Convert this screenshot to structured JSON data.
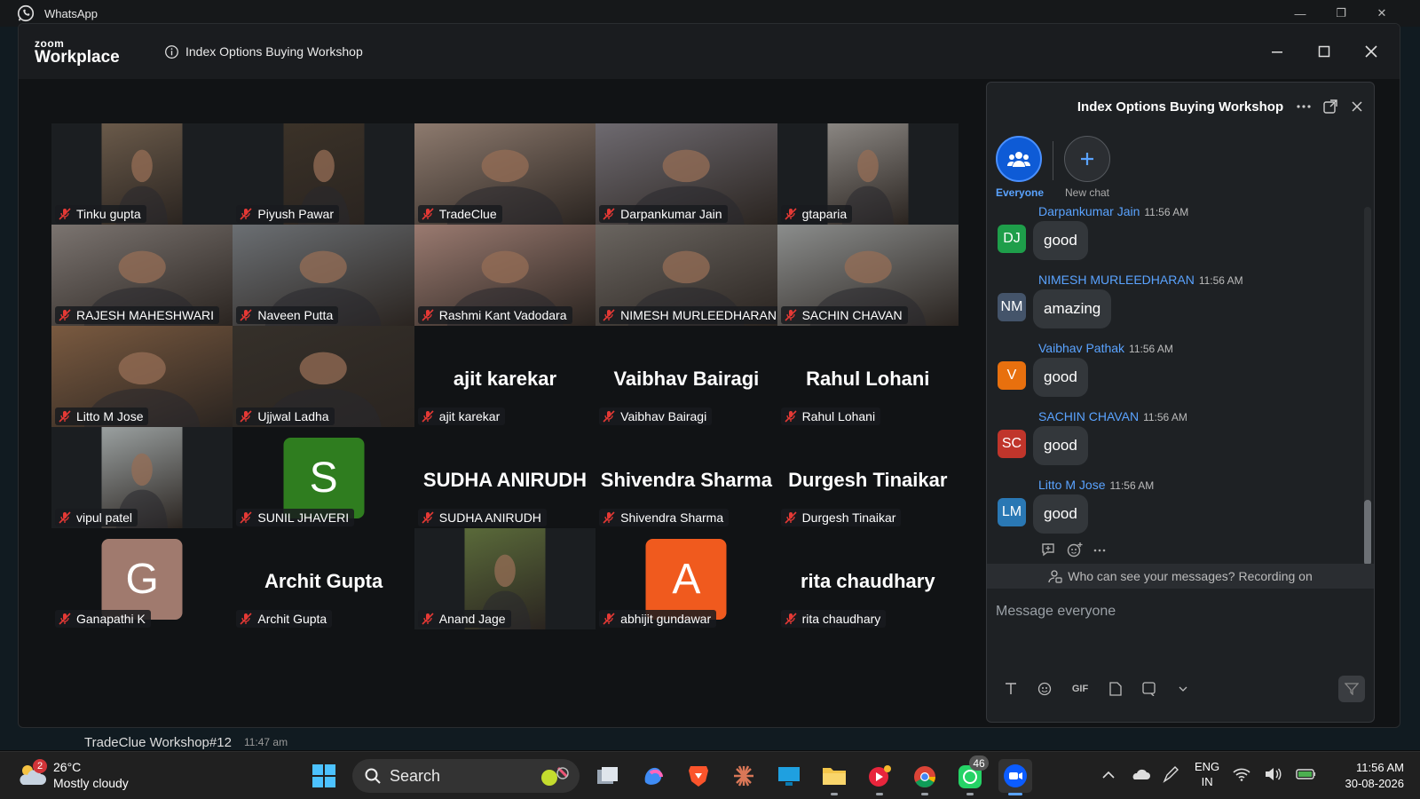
{
  "whatsapp": {
    "title": "WhatsApp",
    "behind_chat": {
      "name": "TradeClue Workshop#12",
      "time": "11:47 am"
    }
  },
  "zoom": {
    "logo_small": "zoom",
    "logo_big": "Workplace",
    "meeting_title": "Index Options Buying Workshop",
    "participants": [
      {
        "name": "Tinku gupta",
        "type": "video",
        "tone": "#6a5a4a"
      },
      {
        "name": "Piyush Pawar",
        "type": "video",
        "tone": "#3b3228"
      },
      {
        "name": "TradeClue",
        "type": "video",
        "tone": "#8d7a6e",
        "active": true
      },
      {
        "name": "Darpankumar Jain",
        "type": "video",
        "tone": "#6e6a70"
      },
      {
        "name": "gtaparia",
        "type": "video",
        "tone": "#8a8682"
      },
      {
        "name": "RAJESH MAHESHWARI",
        "type": "video",
        "tone": "#7b7470"
      },
      {
        "name": "Naveen Putta",
        "type": "video",
        "tone": "#6b6f73"
      },
      {
        "name": "Rashmi Kant Vadodara",
        "type": "video",
        "tone": "#9a7a70"
      },
      {
        "name": "NIMESH MURLEEDHARAN",
        "type": "video",
        "tone": "#6a6560"
      },
      {
        "name": "SACHIN CHAVAN",
        "type": "video",
        "tone": "#8b8d8c"
      },
      {
        "name": "Litto M Jose",
        "type": "video",
        "tone": "#7a5a40"
      },
      {
        "name": "Ujjwal Ladha",
        "type": "video",
        "tone": "#35302a"
      },
      {
        "name": "ajit karekar",
        "type": "name"
      },
      {
        "name": "Vaibhav Bairagi",
        "type": "name"
      },
      {
        "name": "Rahul Lohani",
        "type": "name"
      },
      {
        "name": "vipul patel",
        "type": "video",
        "tone": "#9aa0a0"
      },
      {
        "name": "SUNIL JHAVERI",
        "type": "avatar",
        "initial": "S",
        "color": "#2f7d1f"
      },
      {
        "name": "SUDHA ANIRUDH",
        "type": "name"
      },
      {
        "name": "Shivendra Sharma",
        "type": "name"
      },
      {
        "name": "Durgesh Tinaikar",
        "type": "name"
      },
      {
        "name": "Ganapathi K",
        "type": "avatar",
        "initial": "G",
        "color": "#a07a6e"
      },
      {
        "name": "Archit Gupta",
        "type": "name"
      },
      {
        "name": "Anand Jage",
        "type": "video",
        "tone": "#5a6a3a"
      },
      {
        "name": "abhijit gundawar",
        "type": "avatar",
        "initial": "A",
        "color": "#f05a1e"
      },
      {
        "name": "rita chaudhary",
        "type": "name"
      }
    ]
  },
  "chat": {
    "title": "Index Options Buying Workshop",
    "tabs": [
      {
        "label": "Everyone"
      },
      {
        "label": "New chat"
      }
    ],
    "messages": [
      {
        "initials": "DJ",
        "color": "#1e9e4a",
        "name": "Darpankumar Jain",
        "time": "11:56 AM",
        "text": "good"
      },
      {
        "initials": "NM",
        "color": "#44546a",
        "name": "NIMESH MURLEEDHARAN",
        "time": "11:56 AM",
        "text": "amazing"
      },
      {
        "initials": "V",
        "color": "#e8700e",
        "name": "Vaibhav Pathak",
        "time": "11:56 AM",
        "text": "good"
      },
      {
        "initials": "SC",
        "color": "#c0352b",
        "name": "SACHIN CHAVAN",
        "time": "11:56 AM",
        "text": "good"
      },
      {
        "initials": "LM",
        "color": "#2a78b4",
        "name": "Litto M Jose",
        "time": "11:56 AM",
        "text": "good"
      }
    ],
    "privacy_text": "Who can see your messages? Recording on",
    "compose_placeholder": "Message everyone",
    "gif_label": "GIF"
  },
  "taskbar": {
    "weather_temp": "26°C",
    "weather_desc": "Mostly cloudy",
    "weather_badge": "2",
    "search_label": "Search",
    "whatsapp_badge": "46",
    "lang_top": "ENG",
    "lang_bottom": "IN",
    "time": "11:56 AM",
    "date": "30-08-2026"
  }
}
